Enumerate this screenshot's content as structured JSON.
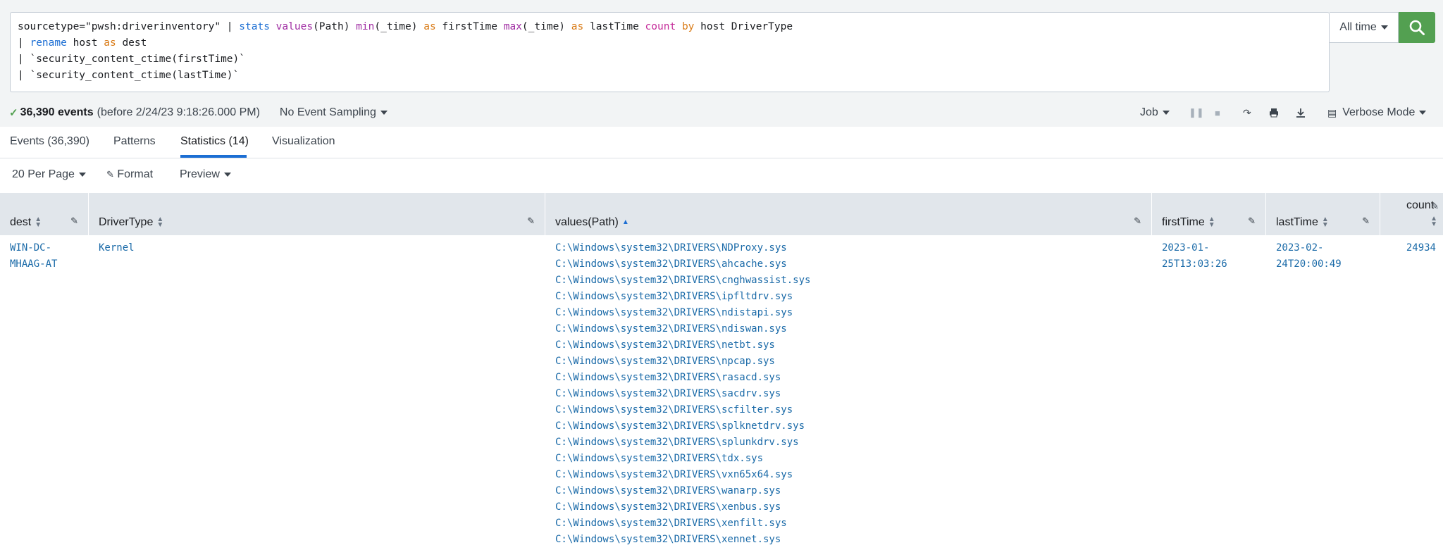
{
  "search": {
    "query_lines": [
      "sourcetype=\"pwsh:driverinventory\" | stats values(Path) min(_time) as firstTime max(_time) as lastTime count by host DriverType",
      "| rename host as dest",
      "| `security_content_ctime(firstTime)`",
      "| `security_content_ctime(lastTime)`"
    ],
    "time_range": "All time"
  },
  "status": {
    "events_count": "36,390 events",
    "events_before": "(before 2/24/23 9:18:26.000 PM)",
    "sampling": "No Event Sampling",
    "job": "Job",
    "mode": "Verbose Mode"
  },
  "tabs": [
    "Events (36,390)",
    "Patterns",
    "Statistics (14)",
    "Visualization"
  ],
  "toolbar": {
    "per_page": "20 Per Page",
    "format": "Format",
    "preview": "Preview"
  },
  "table": {
    "columns": [
      "dest",
      "DriverType",
      "values(Path)",
      "firstTime",
      "lastTime",
      "count"
    ],
    "row": {
      "dest": "WIN-DC-\nMHAAG-AT",
      "driver_type": "Kernel",
      "paths": [
        "C:\\Windows\\system32\\DRIVERS\\NDProxy.sys",
        "C:\\Windows\\system32\\DRIVERS\\ahcache.sys",
        "C:\\Windows\\system32\\DRIVERS\\cnghwassist.sys",
        "C:\\Windows\\system32\\DRIVERS\\ipfltdrv.sys",
        "C:\\Windows\\system32\\DRIVERS\\ndistapi.sys",
        "C:\\Windows\\system32\\DRIVERS\\ndiswan.sys",
        "C:\\Windows\\system32\\DRIVERS\\netbt.sys",
        "C:\\Windows\\system32\\DRIVERS\\npcap.sys",
        "C:\\Windows\\system32\\DRIVERS\\rasacd.sys",
        "C:\\Windows\\system32\\DRIVERS\\sacdrv.sys",
        "C:\\Windows\\system32\\DRIVERS\\scfilter.sys",
        "C:\\Windows\\system32\\DRIVERS\\splknetdrv.sys",
        "C:\\Windows\\system32\\DRIVERS\\splunkdrv.sys",
        "C:\\Windows\\system32\\DRIVERS\\tdx.sys",
        "C:\\Windows\\system32\\DRIVERS\\vxn65x64.sys",
        "C:\\Windows\\system32\\DRIVERS\\wanarp.sys",
        "C:\\Windows\\system32\\DRIVERS\\xenbus.sys",
        "C:\\Windows\\system32\\DRIVERS\\xenfilt.sys",
        "C:\\Windows\\system32\\DRIVERS\\xennet.sys"
      ],
      "first_time": "2023-01-\n25T13:03:26",
      "last_time": "2023-02-\n24T20:00:49",
      "count": "24934"
    }
  },
  "colors": {
    "accent": "#1c6ed3",
    "search_button": "#53a051",
    "link_text": "#1a6aa8"
  }
}
